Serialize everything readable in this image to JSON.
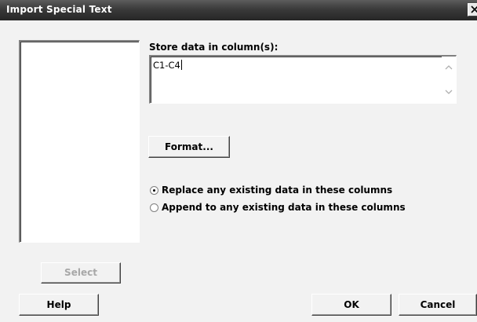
{
  "window": {
    "title": "Import Special Text"
  },
  "store": {
    "label": "Store data in column(s):",
    "value": "C1-C4"
  },
  "buttons": {
    "format": "Format...",
    "select": "Select",
    "help": "Help",
    "ok": "OK",
    "cancel": "Cancel"
  },
  "options": {
    "selected": "replace",
    "replace_label": "Replace any existing data in these columns",
    "append_label": "Append to any existing data in these columns"
  },
  "icons": {
    "close": "close-icon",
    "scroll_up": "scroll-up-arrow-icon",
    "scroll_down": "scroll-down-arrow-icon"
  }
}
